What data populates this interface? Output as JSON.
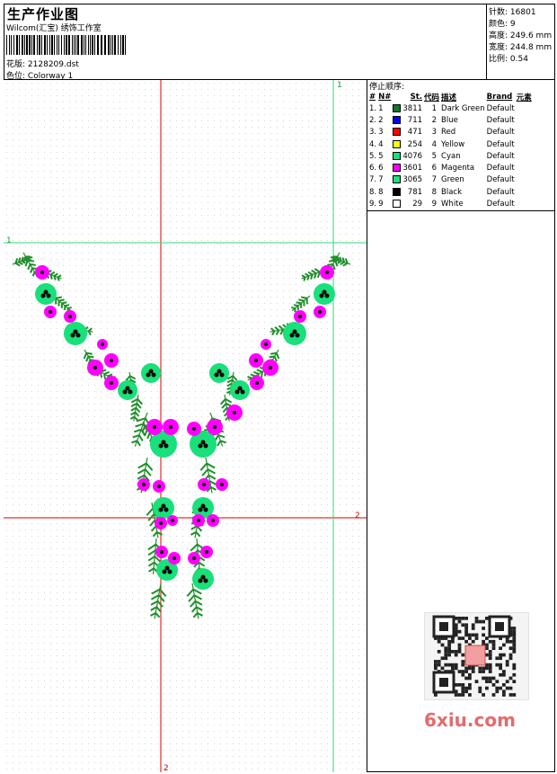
{
  "header": {
    "title": "生产作业图",
    "company": "Wilcom(汇宝) 绣饰工作室",
    "design_label": "花版:",
    "design_value": "2128209.dst",
    "colorway_label": "色位:",
    "colorway_value": "Colorway 1"
  },
  "stats": {
    "stitches_label": "针数:",
    "stitches_value": "16801",
    "colors_label": "颜色:",
    "colors_value": "9",
    "height_label": "高度:",
    "height_value": "249.6 mm",
    "width_label": "宽度:",
    "width_value": "244.8 mm",
    "scale_label": "比例:",
    "scale_value": "0.54"
  },
  "sequence": {
    "title": "停止顺序:",
    "headers": [
      "#",
      "N#",
      "St.",
      "代码",
      "描述",
      "Brand",
      "元素"
    ],
    "rows": [
      {
        "idx": "1.",
        "n": "1",
        "st": "3811",
        "code": "1",
        "desc": "Dark Green",
        "brand": "Default",
        "color": "#0a7a2a"
      },
      {
        "idx": "2.",
        "n": "2",
        "st": "711",
        "code": "2",
        "desc": "Blue",
        "brand": "Default",
        "color": "#0000ff"
      },
      {
        "idx": "3.",
        "n": "3",
        "st": "471",
        "code": "3",
        "desc": "Red",
        "brand": "Default",
        "color": "#ff0000"
      },
      {
        "idx": "4.",
        "n": "4",
        "st": "254",
        "code": "4",
        "desc": "Yellow",
        "brand": "Default",
        "color": "#ffff00"
      },
      {
        "idx": "5.",
        "n": "5",
        "st": "4076",
        "code": "5",
        "desc": "Cyan",
        "brand": "Default",
        "color": "#18e07a"
      },
      {
        "idx": "6.",
        "n": "6",
        "st": "3601",
        "code": "6",
        "desc": "Magenta",
        "brand": "Default",
        "color": "#ff00ff"
      },
      {
        "idx": "7.",
        "n": "7",
        "st": "3065",
        "code": "7",
        "desc": "Green",
        "brand": "Default",
        "color": "#20e080"
      },
      {
        "idx": "8.",
        "n": "8",
        "st": "781",
        "code": "8",
        "desc": "Black",
        "brand": "Default",
        "color": "#000000"
      },
      {
        "idx": "9.",
        "n": "9",
        "st": "29",
        "code": "9",
        "desc": "White",
        "brand": "Default",
        "color": "#ffffff"
      }
    ]
  },
  "markers": {
    "one": "1",
    "two": "2"
  },
  "watermark": "6xiu.com",
  "colors": {
    "grid_red": "#dd0000",
    "grid_green": "#33dd77",
    "leaf": "#1f8f2a",
    "bloom_green": "#18e07a",
    "bloom_pink": "#ff00ff"
  }
}
